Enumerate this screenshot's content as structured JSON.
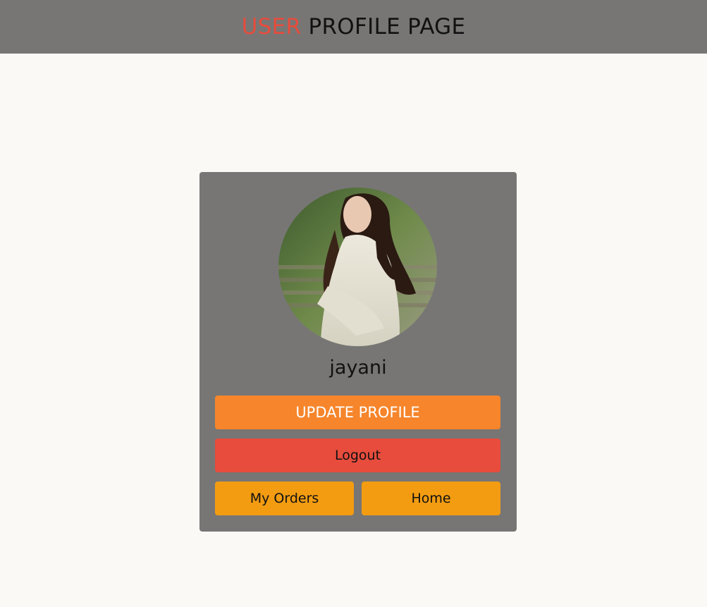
{
  "header": {
    "title_accent": "USER",
    "title_rest": " PROFILE PAGE"
  },
  "profile": {
    "username": "jayani",
    "avatar_icon": "user-photo-avatar"
  },
  "actions": {
    "update_label": "UPDATE PROFILE",
    "logout_label": "Logout",
    "orders_label": "My Orders",
    "home_label": "Home"
  },
  "colors": {
    "header_bg": "#787675",
    "page_bg": "#faf9f6",
    "card_bg": "#777675",
    "accent_red": "#e74c3c",
    "update_orange": "#f6852b",
    "nav_orange": "#f39c12"
  }
}
